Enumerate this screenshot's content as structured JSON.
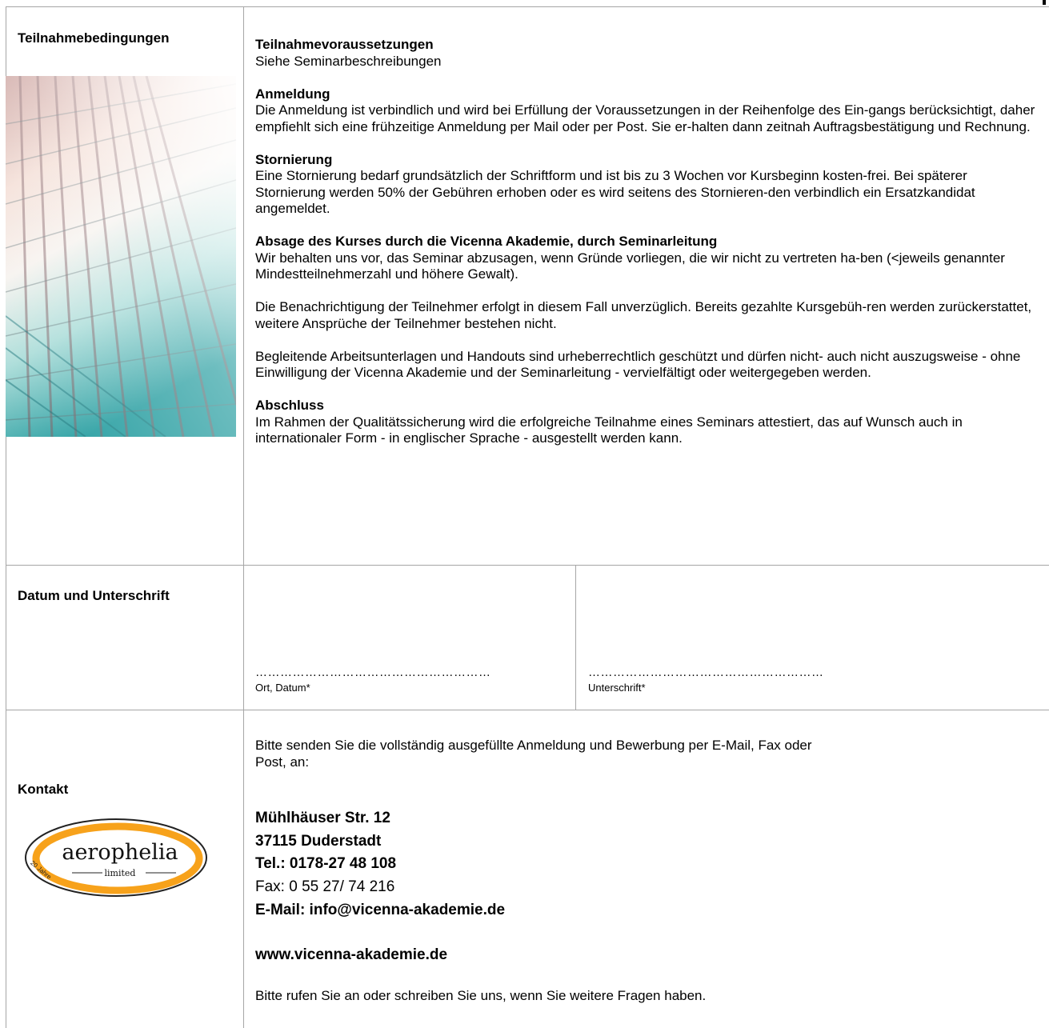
{
  "sections": {
    "terms_label": "Teilnahmebedingungen",
    "date_label": "Datum und Unterschrift",
    "contact_label": "Kontakt"
  },
  "terms": {
    "prereq_title": "Teilnahmevoraussetzungen",
    "prereq_text": "Siehe Seminarbeschreibungen",
    "registration_title": "Anmeldung",
    "registration_text": "Die Anmeldung ist verbindlich und wird bei Erfüllung der Voraussetzungen in der Reihenfolge des Ein-gangs berücksichtigt, daher empfiehlt sich eine frühzeitige Anmeldung per Mail oder per Post. Sie er-halten dann zeitnah Auftragsbestätigung und Rechnung.",
    "cancel_title": "Stornierung",
    "cancel_text": "Eine Stornierung bedarf grundsätzlich der Schriftform und ist bis zu 3 Wochen vor Kursbeginn kosten-frei. Bei späterer Stornierung werden 50% der Gebühren erhoben oder es wird seitens des Stornieren-den verbindlich ein Ersatzkandidat angemeldet.",
    "course_cancel_title": "Absage des Kurses durch die Vicenna Akademie, durch Seminarleitung",
    "course_cancel_text": "Wir behalten uns vor, das Seminar abzusagen, wenn Gründe vorliegen, die wir nicht zu vertreten ha-ben (<jeweils genannter Mindestteilnehmerzahl und höhere Gewalt).",
    "notification_text": "Die Benachrichtigung der Teilnehmer erfolgt in diesem Fall unverzüglich. Bereits gezahlte Kursgebüh-ren werden zurückerstattet, weitere Ansprüche der Teilnehmer bestehen nicht.",
    "copyright_text": "Begleitende Arbeitsunterlagen und Handouts sind urheberrechtlich geschützt und dürfen nicht- auch nicht auszugsweise - ohne Einwilligung der Vicenna Akademie und der Seminarleitung - vervielfältigt oder weitergegeben werden.",
    "completion_title": "Abschluss",
    "completion_text": "Im Rahmen der Qualitätssicherung wird die erfolgreiche Teilnahme eines Seminars attestiert, das auf Wunsch auch in internationaler Form - in englischer Sprache - ausgestellt werden kann."
  },
  "signature": {
    "dots": "…………………………………………………",
    "place_date_label": "Ort, Datum*",
    "signature_label": "Unterschrift*"
  },
  "contact": {
    "intro": "Bitte senden Sie die vollständig ausgefüllte Anmeldung und Bewerbung per E-Mail, Fax oder Post, an:",
    "street": "Mühlhäuser Str. 12",
    "city": "37115 Duderstadt",
    "phone": "Tel.: 0178-27 48 108",
    "fax": "Fax: 0 55 27/ 74 216",
    "email": "E-Mail: info@vicenna-akademie.de",
    "web": "www.vicenna-akademie.de",
    "closing": "Bitte rufen Sie an oder schreiben Sie uns, wenn Sie weitere Fragen haben."
  },
  "logo": {
    "name": "aerophelia",
    "sub": "limited",
    "badge": "20 Jahre"
  },
  "colors": {
    "logo_orange": "#f7a21b",
    "grid": "#a6a6a6"
  }
}
